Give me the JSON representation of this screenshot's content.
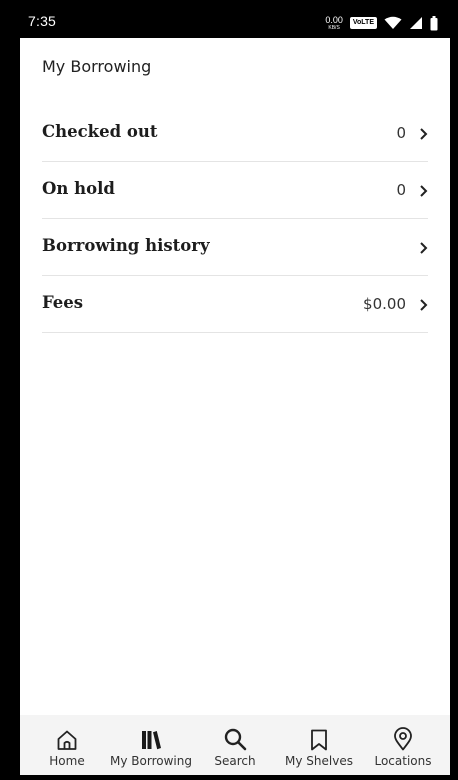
{
  "status_bar": {
    "time": "7:35",
    "net_speed_value": "0.00",
    "net_speed_unit": "KB/S",
    "volte": "VoLTE",
    "icons": [
      "wifi-icon",
      "signal-icon",
      "battery-icon"
    ]
  },
  "page": {
    "title": "My Borrowing"
  },
  "list": {
    "items": [
      {
        "label": "Checked out",
        "value": "0"
      },
      {
        "label": "On hold",
        "value": "0"
      },
      {
        "label": "Borrowing history",
        "value": ""
      },
      {
        "label": "Fees",
        "value": "$0.00"
      }
    ]
  },
  "bottom_nav": {
    "items": [
      {
        "label": "Home",
        "icon": "home-icon"
      },
      {
        "label": "My Borrowing",
        "icon": "books-icon"
      },
      {
        "label": "Search",
        "icon": "search-icon"
      },
      {
        "label": "My Shelves",
        "icon": "bookmark-icon"
      },
      {
        "label": "Locations",
        "icon": "location-pin-icon"
      }
    ]
  },
  "colors": {
    "background": "#ffffff",
    "status_bar": "#000000",
    "nav_background": "#f4f4f4",
    "text": "#1d1d1d",
    "divider": "#e4e4e4"
  }
}
